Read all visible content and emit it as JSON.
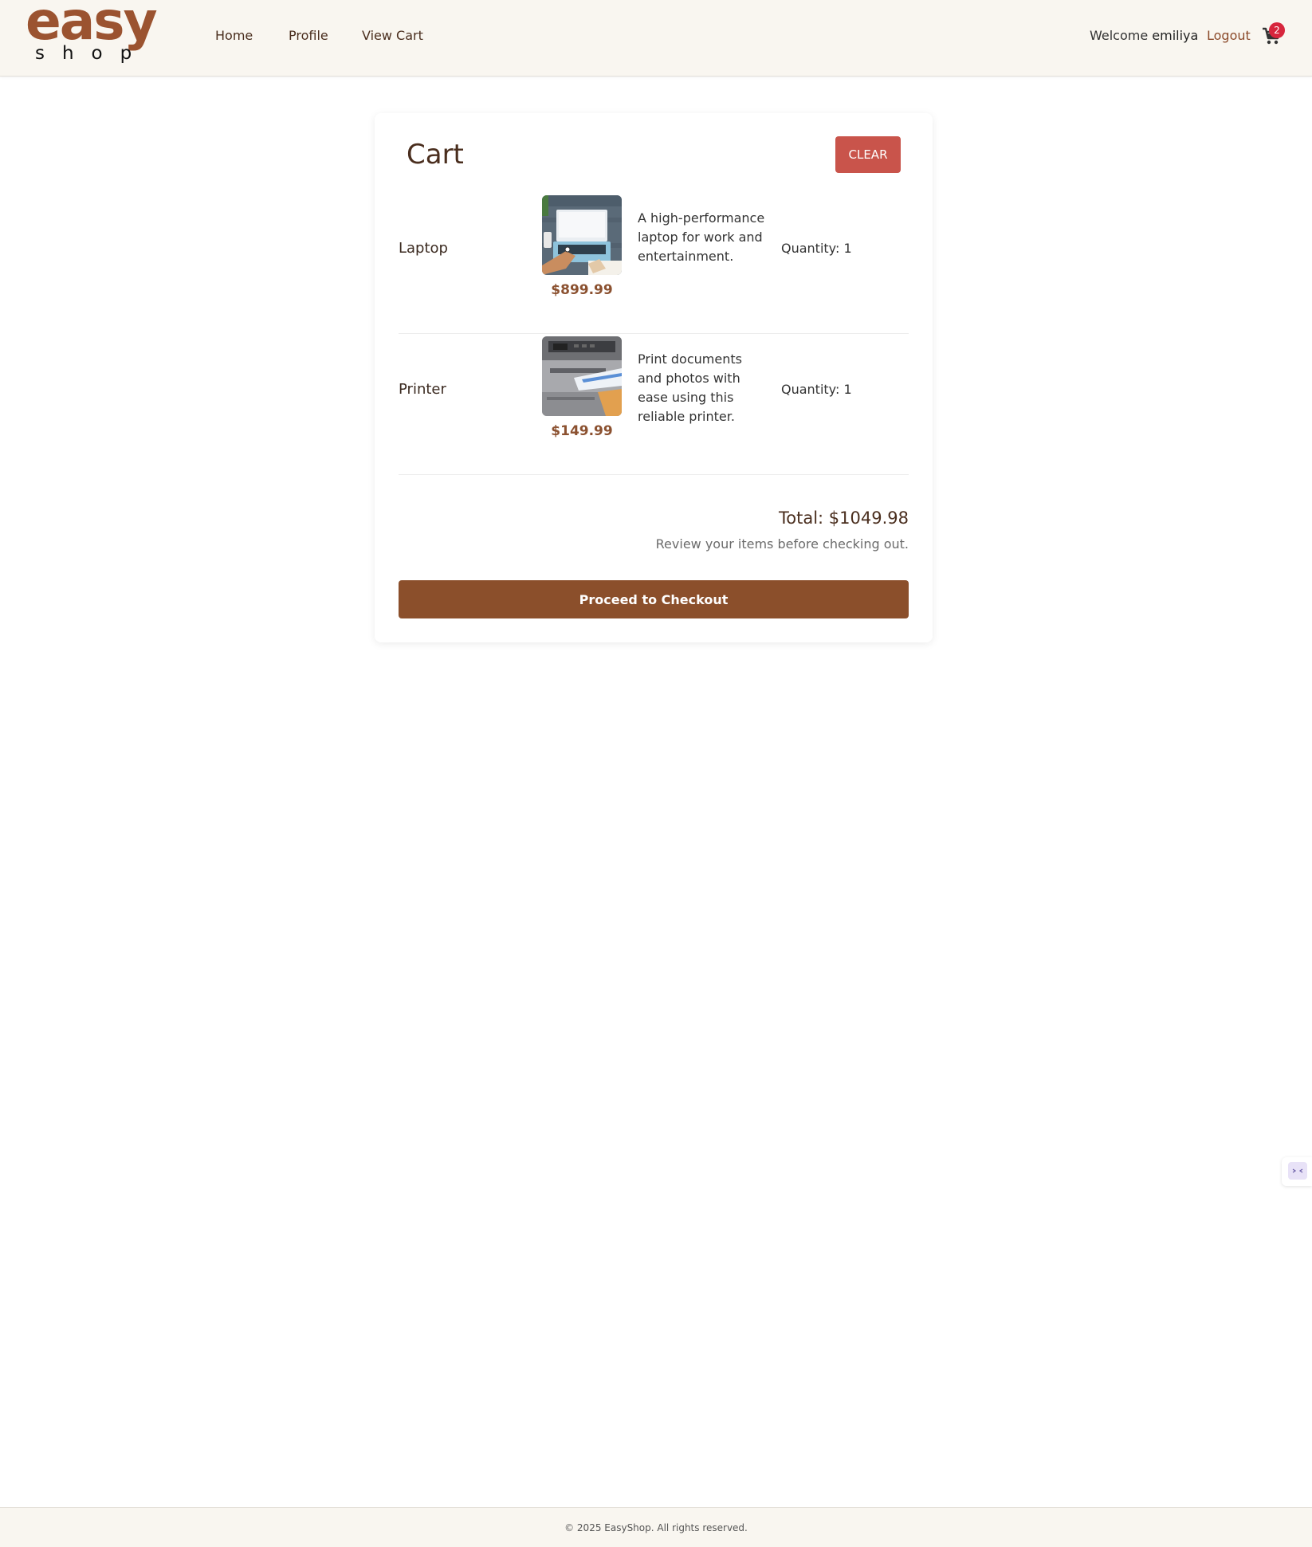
{
  "logo": {
    "line1": "easy",
    "line2": "shop"
  },
  "nav": {
    "home": "Home",
    "profile": "Profile",
    "view_cart": "View Cart"
  },
  "user": {
    "welcome": "Welcome",
    "username": "emiliya",
    "logout": "Logout",
    "cart_count": "2"
  },
  "cart": {
    "title": "Cart",
    "clear_label": "CLEAR",
    "items": [
      {
        "name": "Laptop",
        "price": "$899.99",
        "description": "A high-performance laptop for work and entertainment.",
        "quantity": "Quantity: 1"
      },
      {
        "name": "Printer",
        "price": "$149.99",
        "description": "Print documents and photos with ease using this reliable printer.",
        "quantity": "Quantity: 1"
      }
    ],
    "total": "Total: $1049.98",
    "review_note": "Review your items before checking out.",
    "checkout_label": "Proceed to Checkout"
  },
  "footer": {
    "text": "© 2025 EasyShop. All rights reserved."
  },
  "colors": {
    "brand": "#9b5330",
    "header_bg": "#f9f6f0",
    "clear_button": "#c9544b",
    "checkout_button": "#8b4f2b",
    "badge": "#d7263d"
  },
  "icons": [
    "cart-icon",
    "chat-widget-icon"
  ]
}
